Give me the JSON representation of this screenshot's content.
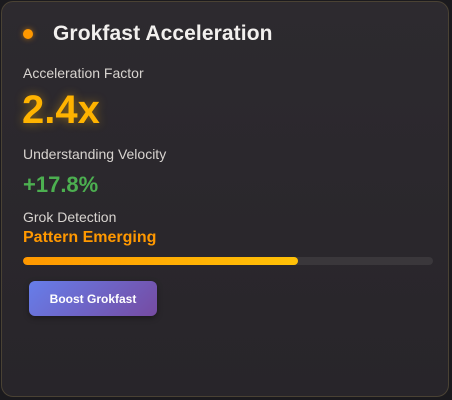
{
  "card": {
    "title": "Grokfast Acceleration",
    "status_dot_icon": "status-dot-icon"
  },
  "acceleration": {
    "label": "Acceleration Factor",
    "value": "2.4x"
  },
  "velocity": {
    "label": "Understanding Velocity",
    "value": "+17.8%"
  },
  "grok_detection": {
    "label": "Grok Detection",
    "status": "Pattern Emerging",
    "progress_percent": 67
  },
  "actions": {
    "boost_label": "Boost Grokfast"
  },
  "colors": {
    "accent_orange": "#ff9800",
    "factor_amber": "#ffb300",
    "velocity_green": "#4caf50",
    "button_gradient_start": "#667eea",
    "button_gradient_end": "#764ba2"
  }
}
